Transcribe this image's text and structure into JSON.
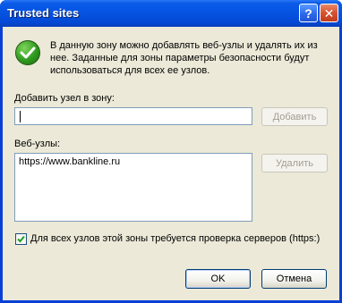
{
  "window": {
    "title": "Trusted sites"
  },
  "titlebar_buttons": {
    "help": "?",
    "close": "✕"
  },
  "info": {
    "icon": "green-check-icon",
    "text": "В данную зону можно добавлять веб-узлы и удалять их из нее. Заданные для зоны параметры безопасности будут использоваться для всех ее узлов."
  },
  "add_site": {
    "label": "Добавить узел в зону:",
    "value": "",
    "add_button": "Добавить"
  },
  "sites": {
    "label": "Веб-узлы:",
    "items": [
      "https://www.bankline.ru"
    ],
    "remove_button": "Удалить"
  },
  "server_verification": {
    "label": "Для всех узлов этой зоны требуется проверка серверов (https:)",
    "checked": true
  },
  "footer": {
    "ok": "OK",
    "cancel": "Отмена"
  },
  "colors": {
    "titlebar": "#0553e0",
    "client": "#ece9d8",
    "check_green": "#2f9a1e"
  }
}
